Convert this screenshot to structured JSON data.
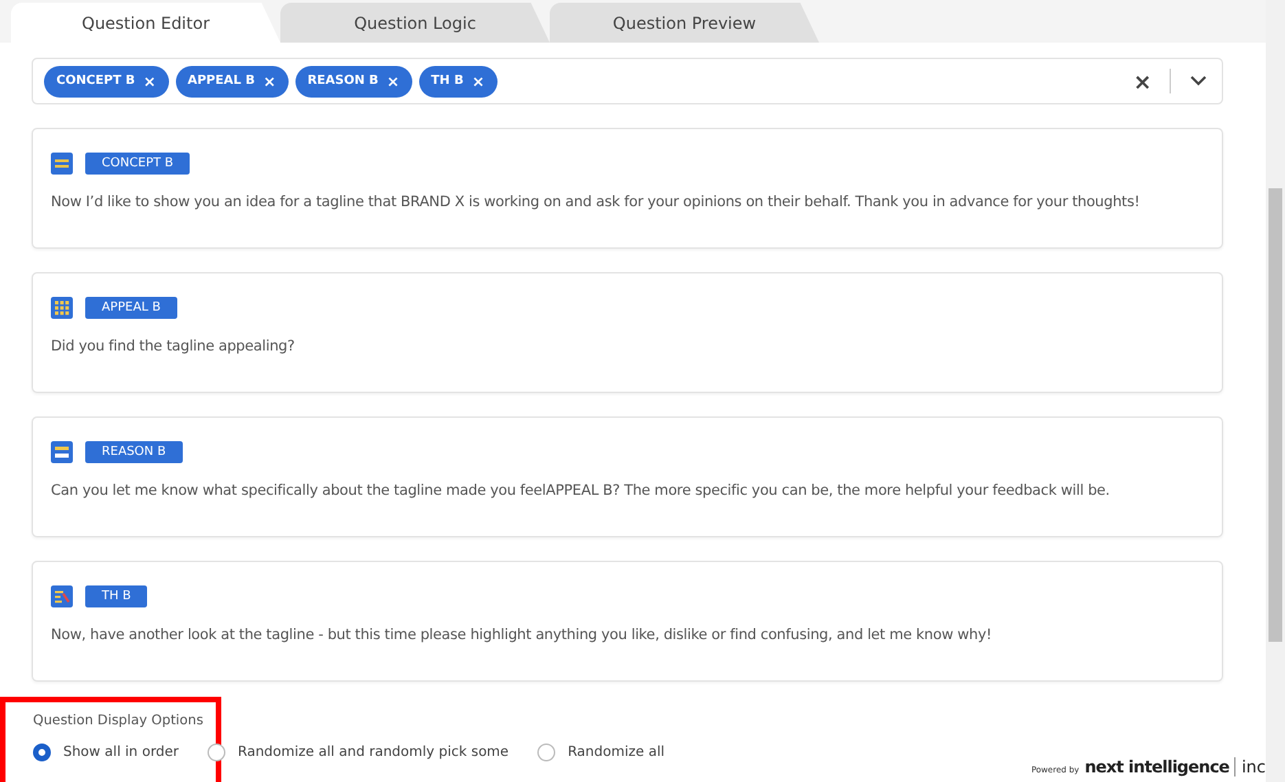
{
  "tabs": [
    {
      "label": "Question Editor",
      "selected": true
    },
    {
      "label": "Question Logic",
      "selected": false
    },
    {
      "label": "Question Preview",
      "selected": false
    }
  ],
  "chips": [
    {
      "label": "CONCEPT B",
      "remove": "×"
    },
    {
      "label": "APPEAL B",
      "remove": "×"
    },
    {
      "label": "REASON B",
      "remove": "×"
    },
    {
      "label": "TH B",
      "remove": "×"
    }
  ],
  "chip_clear": "×",
  "questions": [
    {
      "kind": "info",
      "tag": "CONCEPT B",
      "text": "Now I’d like to show you an idea for a tagline that BRAND X is working on and ask for your opinions on their behalf. Thank you in advance for your thoughts!"
    },
    {
      "kind": "grid",
      "tag": "APPEAL B",
      "text": "Did you find the tagline appealing?"
    },
    {
      "kind": "open",
      "tag": "REASON B",
      "text": "Can you let me know what specifically about the tagline made you feelAPPEAL B? The more specific you can be, the more helpful your feedback will be."
    },
    {
      "kind": "highlight",
      "tag": "TH B",
      "text": "Now, have another look at the tagline - but this time please highlight anything you like, dislike or find confusing, and let me know why!"
    }
  ],
  "display_options": {
    "title": "Question Display Options",
    "highlighted": true,
    "options": [
      {
        "label": "Show all in order",
        "selected": true
      },
      {
        "label": "Randomize all and randomly pick some",
        "selected": false
      },
      {
        "label": "Randomize all",
        "selected": false
      }
    ]
  },
  "footer": {
    "powered": "Powered by",
    "brand": "next intelligence",
    "suffix": "inc"
  }
}
